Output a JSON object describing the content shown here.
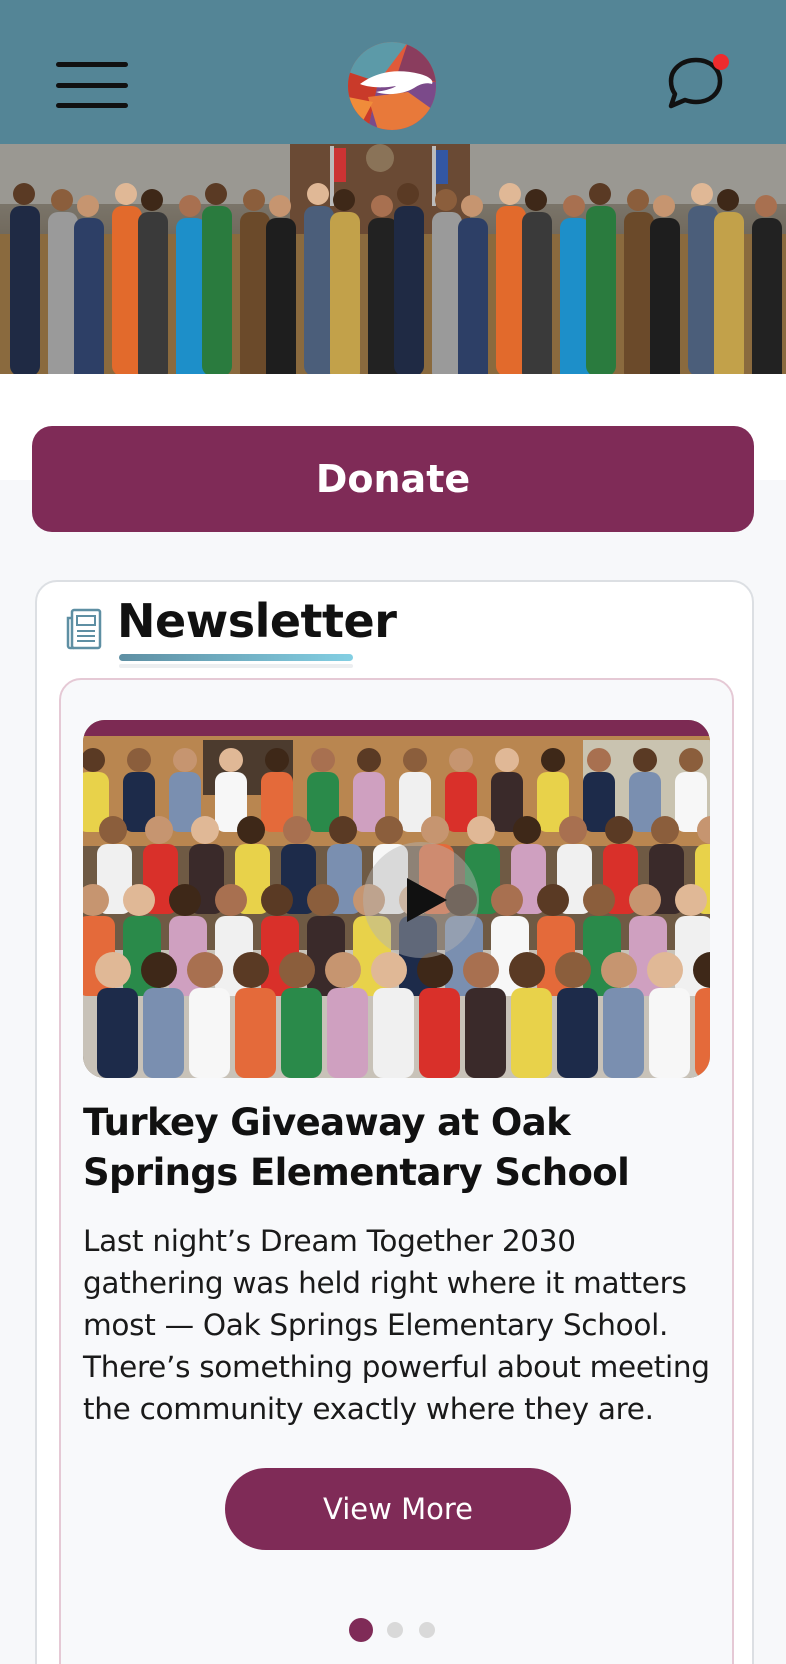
{
  "header": {
    "menu_icon": "hamburger-menu-icon",
    "logo": "dove-logo",
    "chat_icon": "chat-bubble-icon",
    "notification": "unread-dot",
    "colors": {
      "background": "#548596",
      "notification": "#ef2b2d"
    }
  },
  "hero": {
    "image": "group photo of officials and community members"
  },
  "donate": {
    "label": "Donate",
    "color": "#7f2b57"
  },
  "newsletter": {
    "icon": "newspaper-icon",
    "title": "Newsletter",
    "article": {
      "video_thumbnail": "crowd of children and adults in school cafeteria",
      "play_icon": "play-icon",
      "title": "Turkey Giveaway at Oak Springs Elementary School",
      "body": "Last night’s Dream Together 2030 gathering was held right where it matters most — Oak Springs Elementary School. There’s something powerful about meeting the community exactly where they are.",
      "button_label": "View More"
    },
    "pagination": {
      "total": 3,
      "active": 1
    }
  }
}
